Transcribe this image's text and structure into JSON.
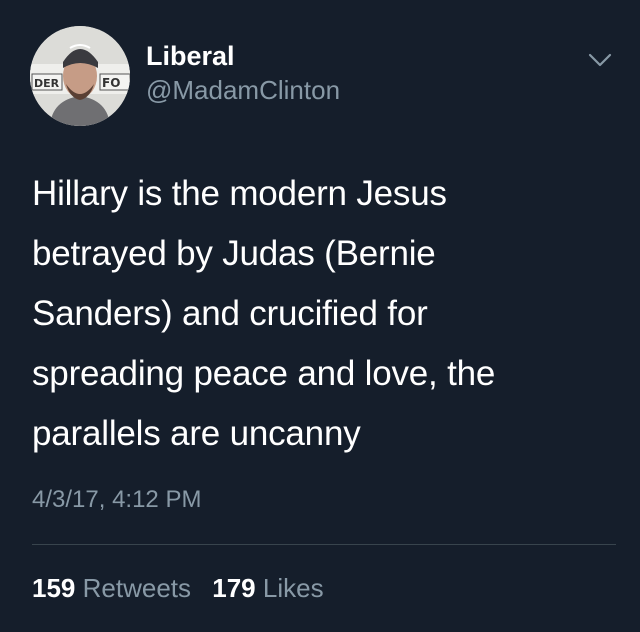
{
  "user": {
    "display_name": "Liberal",
    "handle": "@MadamClinton",
    "avatar_icon": "profile-photo",
    "avatar_text_left": "DER",
    "avatar_text_right": "FO"
  },
  "menu": {
    "icon": "chevron-down-icon"
  },
  "tweet": {
    "text": "Hillary is the modern Jesus\nbetrayed by Judas (Bernie\nSanders) and crucified for\nspreading peace and love, the\nparallels are uncanny",
    "timestamp": "4/3/17, 4:12 PM"
  },
  "stats": {
    "retweets_count": "159",
    "retweets_label": "Retweets",
    "likes_count": "179",
    "likes_label": "Likes"
  },
  "colors": {
    "background": "#151e2b",
    "primary_text": "#ffffff",
    "secondary_text": "#8899a6",
    "divider": "#38444d"
  }
}
